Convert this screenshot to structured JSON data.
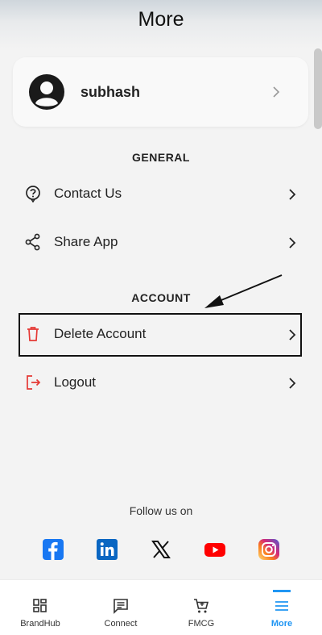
{
  "header": {
    "title": "More"
  },
  "profile": {
    "name": "subhash",
    "avatar_icon": "user-avatar-icon"
  },
  "sections": {
    "general": {
      "title": "GENERAL",
      "items": [
        {
          "label": "Contact Us",
          "icon": "help-circle-icon"
        },
        {
          "label": "Share App",
          "icon": "share-icon"
        }
      ]
    },
    "account": {
      "title": "ACCOUNT",
      "items": [
        {
          "label": "Delete Account",
          "icon": "trash-icon"
        },
        {
          "label": "Logout",
          "icon": "logout-icon"
        }
      ]
    }
  },
  "social": {
    "title": "Follow us on",
    "items": [
      "facebook",
      "linkedin",
      "x",
      "youtube",
      "instagram"
    ]
  },
  "bottom_nav": {
    "items": [
      {
        "label": "BrandHub",
        "icon": "grid-icon"
      },
      {
        "label": "Connect",
        "icon": "message-icon"
      },
      {
        "label": "FMCG",
        "icon": "cart-icon"
      },
      {
        "label": "More",
        "icon": "menu-icon",
        "active": true
      }
    ]
  },
  "colors": {
    "accent": "#2196f3",
    "danger": "#e53935",
    "facebook": "#1877f2",
    "linkedin": "#0a66c2",
    "youtube": "#ff0000"
  }
}
